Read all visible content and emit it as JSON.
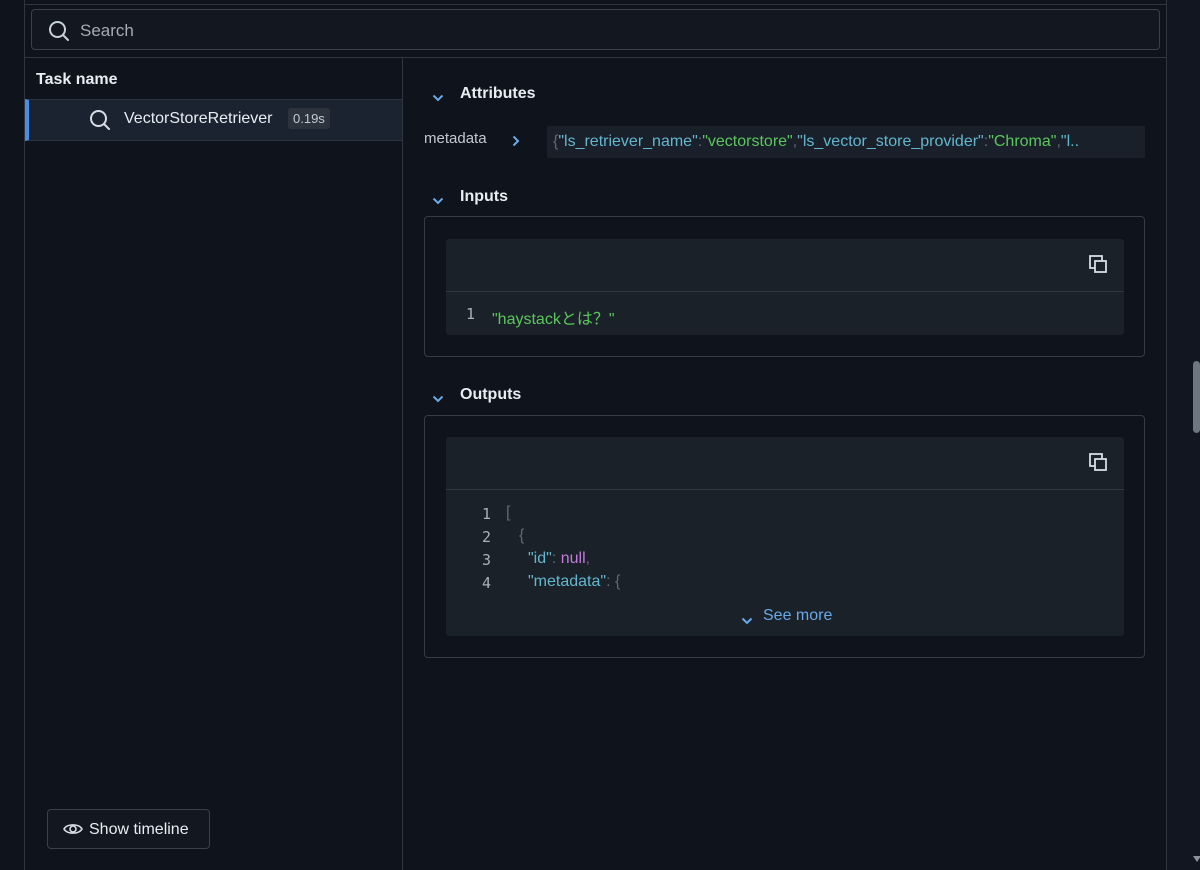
{
  "search": {
    "placeholder": "Search",
    "value": ""
  },
  "task_list": {
    "header": "Task name",
    "items": [
      {
        "name": "VectorStoreRetriever",
        "duration": "0.19s",
        "icon": "search-icon"
      }
    ]
  },
  "timeline_button": {
    "label": "Show timeline",
    "icon": "eye-icon"
  },
  "attributes": {
    "title": "Attributes",
    "rows": [
      {
        "key": "metadata",
        "value_tokens": {
          "open": "{",
          "k1": "\"ls_retriever_name\"",
          "colon1": ":",
          "v1": "\"vectorstore\"",
          "comma1": ",",
          "k2": "\"ls_vector_store_provider\"",
          "colon2": ":",
          "v2": "\"Chroma\"",
          "comma2": ",",
          "trunc": "\"l.."
        }
      }
    ]
  },
  "inputs": {
    "title": "Inputs",
    "lines": [
      {
        "num": "1",
        "text": "\"haystackとは？\""
      }
    ]
  },
  "outputs": {
    "title": "Outputs",
    "lines": [
      {
        "num": "1",
        "text": "["
      },
      {
        "num": "2",
        "text": "{"
      },
      {
        "num": "3",
        "key": "\"id\"",
        "sep": ":",
        "value": "null",
        "trail": ","
      },
      {
        "num": "4",
        "key": "\"metadata\"",
        "sep": ":",
        "trail": "{"
      }
    ],
    "see_more": "See more"
  },
  "colors": {
    "background": "#0f131b",
    "accent": "#4b8ee6",
    "json_key": "#62b7cf",
    "json_string": "#5bc65d",
    "json_null": "#c379d9",
    "link": "#6aa9e8"
  }
}
